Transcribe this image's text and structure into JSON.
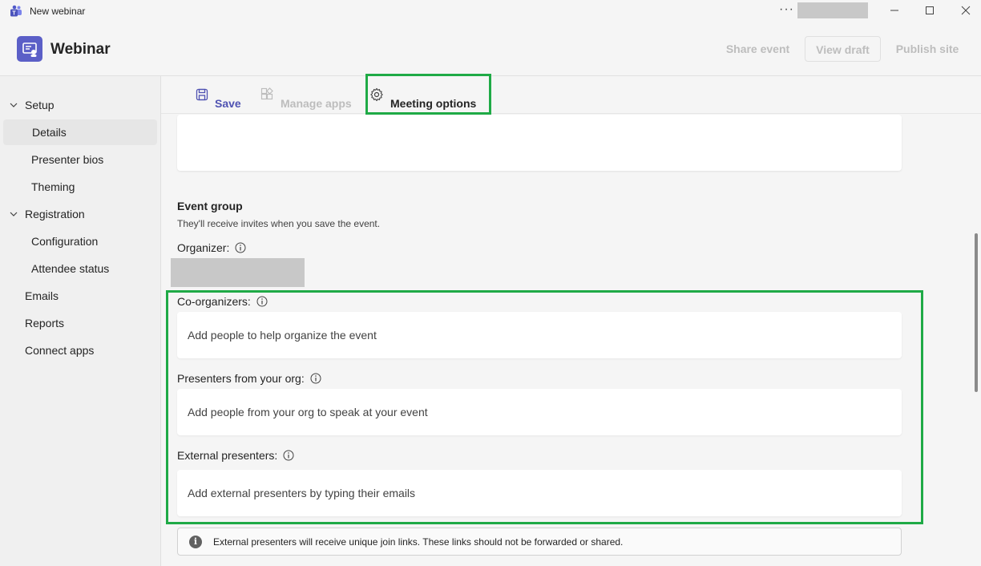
{
  "window": {
    "title": "New webinar",
    "more_label": "···"
  },
  "header": {
    "app_title": "Webinar",
    "share_event": "Share event",
    "view_draft": "View draft",
    "publish_site": "Publish site"
  },
  "sidebar": {
    "items": [
      {
        "label": "Setup"
      },
      {
        "label": "Details"
      },
      {
        "label": "Presenter bios"
      },
      {
        "label": "Theming"
      },
      {
        "label": "Registration"
      },
      {
        "label": "Configuration"
      },
      {
        "label": "Attendee status"
      },
      {
        "label": "Emails"
      },
      {
        "label": "Reports"
      },
      {
        "label": "Connect apps"
      }
    ]
  },
  "toolbar": {
    "save": "Save",
    "manage_apps": "Manage apps",
    "meeting_options": "Meeting options"
  },
  "event_group": {
    "title": "Event group",
    "subtitle": "They'll receive invites when you save the event.",
    "organizer_label": "Organizer:",
    "co_organizers_label": "Co-organizers:",
    "co_organizers_placeholder": "Add people to help organize the event",
    "presenters_label": "Presenters from your org:",
    "presenters_placeholder": "Add people from your org to speak at your event",
    "external_label": "External presenters:",
    "external_placeholder": "Add external presenters by typing their emails",
    "notice": "External presenters will receive unique join links. These links should not be forwarded or shared.",
    "notice_icon": "i"
  },
  "colors": {
    "accent": "#5b5fc7",
    "highlight": "#1faa46"
  }
}
